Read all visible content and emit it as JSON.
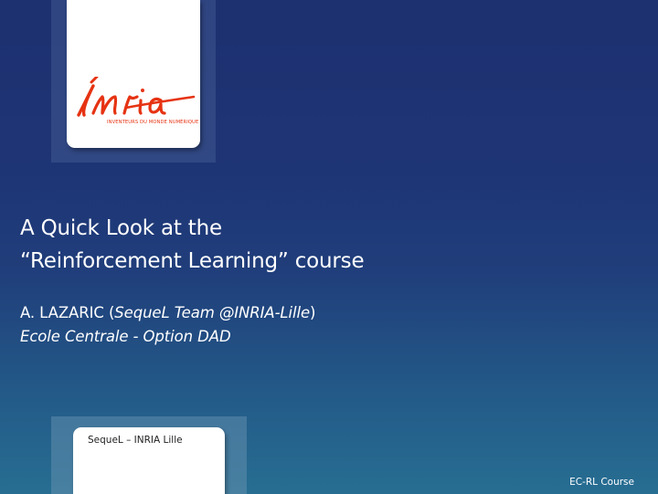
{
  "logo": {
    "wordmark": "Inria",
    "tagline": "INVENTEURS DU MONDE NUMÉRIQUE"
  },
  "title": {
    "line1": "A Quick Look at the",
    "line2": "“Reinforcement Learning” course"
  },
  "author": {
    "name": "A. LAZARIC",
    "open_paren": " (",
    "affiliation": "SequeL Team @INRIA-Lille",
    "close_paren": ")"
  },
  "institute": "Ecole Centrale - Option DAD",
  "footer": {
    "left_box": "SequeL – INRIA Lille",
    "right": "EC-RL Course"
  },
  "colors": {
    "brand_red": "#e63312",
    "background_top": "#1d3070",
    "background_bottom": "#276e92"
  }
}
